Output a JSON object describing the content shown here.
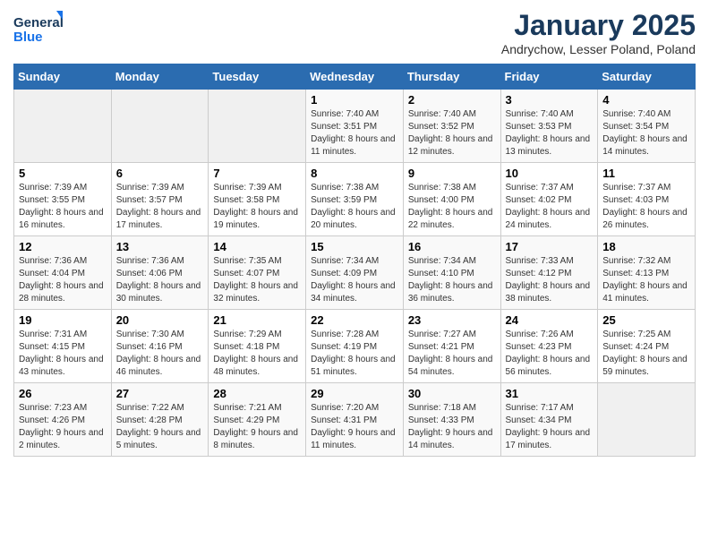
{
  "header": {
    "logo_line1": "General",
    "logo_line2": "Blue",
    "month_title": "January 2025",
    "subtitle": "Andrychow, Lesser Poland, Poland"
  },
  "weekdays": [
    "Sunday",
    "Monday",
    "Tuesday",
    "Wednesday",
    "Thursday",
    "Friday",
    "Saturday"
  ],
  "weeks": [
    [
      {
        "day": "",
        "info": ""
      },
      {
        "day": "",
        "info": ""
      },
      {
        "day": "",
        "info": ""
      },
      {
        "day": "1",
        "info": "Sunrise: 7:40 AM\nSunset: 3:51 PM\nDaylight: 8 hours and 11 minutes."
      },
      {
        "day": "2",
        "info": "Sunrise: 7:40 AM\nSunset: 3:52 PM\nDaylight: 8 hours and 12 minutes."
      },
      {
        "day": "3",
        "info": "Sunrise: 7:40 AM\nSunset: 3:53 PM\nDaylight: 8 hours and 13 minutes."
      },
      {
        "day": "4",
        "info": "Sunrise: 7:40 AM\nSunset: 3:54 PM\nDaylight: 8 hours and 14 minutes."
      }
    ],
    [
      {
        "day": "5",
        "info": "Sunrise: 7:39 AM\nSunset: 3:55 PM\nDaylight: 8 hours and 16 minutes."
      },
      {
        "day": "6",
        "info": "Sunrise: 7:39 AM\nSunset: 3:57 PM\nDaylight: 8 hours and 17 minutes."
      },
      {
        "day": "7",
        "info": "Sunrise: 7:39 AM\nSunset: 3:58 PM\nDaylight: 8 hours and 19 minutes."
      },
      {
        "day": "8",
        "info": "Sunrise: 7:38 AM\nSunset: 3:59 PM\nDaylight: 8 hours and 20 minutes."
      },
      {
        "day": "9",
        "info": "Sunrise: 7:38 AM\nSunset: 4:00 PM\nDaylight: 8 hours and 22 minutes."
      },
      {
        "day": "10",
        "info": "Sunrise: 7:37 AM\nSunset: 4:02 PM\nDaylight: 8 hours and 24 minutes."
      },
      {
        "day": "11",
        "info": "Sunrise: 7:37 AM\nSunset: 4:03 PM\nDaylight: 8 hours and 26 minutes."
      }
    ],
    [
      {
        "day": "12",
        "info": "Sunrise: 7:36 AM\nSunset: 4:04 PM\nDaylight: 8 hours and 28 minutes."
      },
      {
        "day": "13",
        "info": "Sunrise: 7:36 AM\nSunset: 4:06 PM\nDaylight: 8 hours and 30 minutes."
      },
      {
        "day": "14",
        "info": "Sunrise: 7:35 AM\nSunset: 4:07 PM\nDaylight: 8 hours and 32 minutes."
      },
      {
        "day": "15",
        "info": "Sunrise: 7:34 AM\nSunset: 4:09 PM\nDaylight: 8 hours and 34 minutes."
      },
      {
        "day": "16",
        "info": "Sunrise: 7:34 AM\nSunset: 4:10 PM\nDaylight: 8 hours and 36 minutes."
      },
      {
        "day": "17",
        "info": "Sunrise: 7:33 AM\nSunset: 4:12 PM\nDaylight: 8 hours and 38 minutes."
      },
      {
        "day": "18",
        "info": "Sunrise: 7:32 AM\nSunset: 4:13 PM\nDaylight: 8 hours and 41 minutes."
      }
    ],
    [
      {
        "day": "19",
        "info": "Sunrise: 7:31 AM\nSunset: 4:15 PM\nDaylight: 8 hours and 43 minutes."
      },
      {
        "day": "20",
        "info": "Sunrise: 7:30 AM\nSunset: 4:16 PM\nDaylight: 8 hours and 46 minutes."
      },
      {
        "day": "21",
        "info": "Sunrise: 7:29 AM\nSunset: 4:18 PM\nDaylight: 8 hours and 48 minutes."
      },
      {
        "day": "22",
        "info": "Sunrise: 7:28 AM\nSunset: 4:19 PM\nDaylight: 8 hours and 51 minutes."
      },
      {
        "day": "23",
        "info": "Sunrise: 7:27 AM\nSunset: 4:21 PM\nDaylight: 8 hours and 54 minutes."
      },
      {
        "day": "24",
        "info": "Sunrise: 7:26 AM\nSunset: 4:23 PM\nDaylight: 8 hours and 56 minutes."
      },
      {
        "day": "25",
        "info": "Sunrise: 7:25 AM\nSunset: 4:24 PM\nDaylight: 8 hours and 59 minutes."
      }
    ],
    [
      {
        "day": "26",
        "info": "Sunrise: 7:23 AM\nSunset: 4:26 PM\nDaylight: 9 hours and 2 minutes."
      },
      {
        "day": "27",
        "info": "Sunrise: 7:22 AM\nSunset: 4:28 PM\nDaylight: 9 hours and 5 minutes."
      },
      {
        "day": "28",
        "info": "Sunrise: 7:21 AM\nSunset: 4:29 PM\nDaylight: 9 hours and 8 minutes."
      },
      {
        "day": "29",
        "info": "Sunrise: 7:20 AM\nSunset: 4:31 PM\nDaylight: 9 hours and 11 minutes."
      },
      {
        "day": "30",
        "info": "Sunrise: 7:18 AM\nSunset: 4:33 PM\nDaylight: 9 hours and 14 minutes."
      },
      {
        "day": "31",
        "info": "Sunrise: 7:17 AM\nSunset: 4:34 PM\nDaylight: 9 hours and 17 minutes."
      },
      {
        "day": "",
        "info": ""
      }
    ]
  ]
}
